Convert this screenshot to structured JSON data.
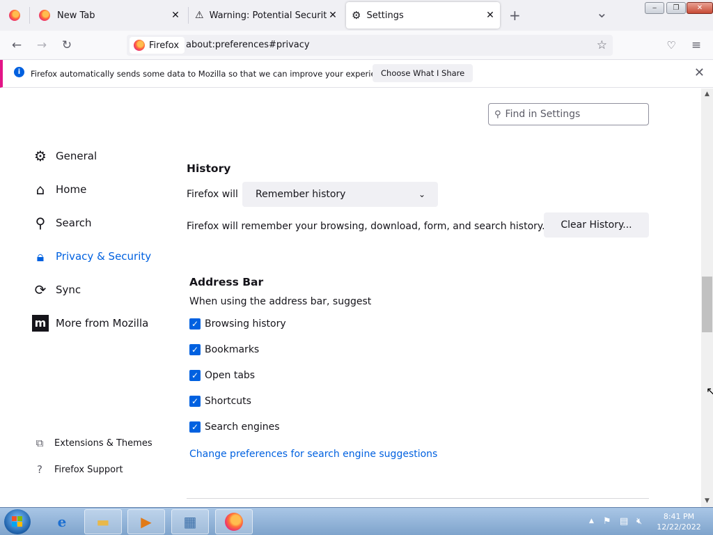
{
  "tabs": [
    {
      "title": "",
      "icon": "firefox-icon"
    },
    {
      "title": "New Tab",
      "icon": "firefox-icon"
    },
    {
      "title": "Warning: Potential Security Risk",
      "icon": "warning-icon"
    },
    {
      "title": "Settings",
      "icon": "gear-icon",
      "active": true
    }
  ],
  "tab_controls": {
    "new_tab": "+",
    "list_all": "⌄"
  },
  "window_buttons": {
    "minimize": "‒",
    "restore": "❐",
    "close": "✕"
  },
  "navbar": {
    "identity_label": "Firefox",
    "url": "about:preferences#privacy"
  },
  "notification": {
    "text": "Firefox automatically sends some data to Mozilla so that we can improve your experience.",
    "button": "Choose What I Share"
  },
  "search": {
    "placeholder": "Find in Settings"
  },
  "categories": [
    {
      "label": "General",
      "icon": "gear-icon"
    },
    {
      "label": "Home",
      "icon": "home-icon"
    },
    {
      "label": "Search",
      "icon": "search-icon"
    },
    {
      "label": "Privacy & Security",
      "icon": "lock-icon",
      "selected": true
    },
    {
      "label": "Sync",
      "icon": "sync-icon"
    },
    {
      "label": "More from Mozilla",
      "icon": "mozilla-icon"
    }
  ],
  "footer_links": [
    {
      "label": "Extensions & Themes",
      "icon": "puzzle-icon"
    },
    {
      "label": "Firefox Support",
      "icon": "help-icon"
    }
  ],
  "history": {
    "title": "History",
    "firefox_will_label": "Firefox will",
    "select_value": "Remember history",
    "description": "Firefox will remember your browsing, download, form, and search history.",
    "clear_button": "Clear History..."
  },
  "address_bar": {
    "title": "Address Bar",
    "subtitle": "When using the address bar, suggest",
    "options": [
      {
        "label": "Browsing history",
        "checked": true
      },
      {
        "label": "Bookmarks",
        "checked": true
      },
      {
        "label": "Open tabs",
        "checked": true
      },
      {
        "label": "Shortcuts",
        "checked": true
      },
      {
        "label": "Search engines",
        "checked": true
      }
    ],
    "link": "Change preferences for search engine suggestions"
  },
  "taskbar": {
    "apps": [
      "internet-explorer-icon",
      "file-explorer-icon",
      "media-player-icon",
      "control-panel-icon",
      "firefox-icon"
    ],
    "clock_time": "8:41 PM",
    "clock_date": "12/22/2022"
  },
  "colors": {
    "accent": "#0061e0",
    "notification_border": "#e31587"
  }
}
